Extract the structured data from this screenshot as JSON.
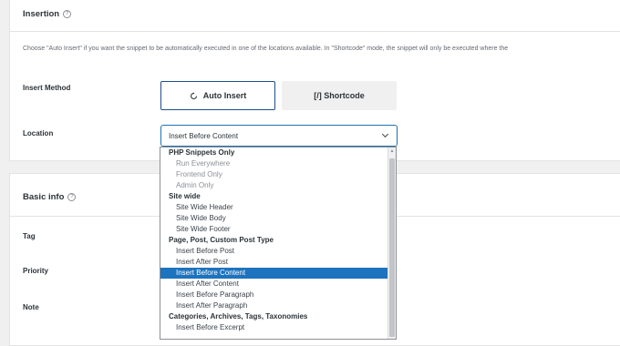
{
  "insertion": {
    "title": "Insertion",
    "description": "Choose \"Auto Insert\" if you want the snippet to be automatically executed in one of the locations available. In \"Shortcode\" mode, the snippet will only be executed where the",
    "insert_method_label": "Insert Method",
    "auto_insert_label": "Auto Insert",
    "shortcode_label": "[/] Shortcode",
    "location_label": "Location",
    "location_value": "Insert Before Content"
  },
  "basic_info": {
    "title": "Basic info",
    "tag_label": "Tag",
    "priority_label": "Priority",
    "note_label": "Note"
  },
  "dropdown": {
    "items": [
      {
        "type": "group",
        "label": "PHP Snippets Only"
      },
      {
        "type": "option",
        "label": "Run Everywhere",
        "state": "disabled"
      },
      {
        "type": "option",
        "label": "Frontend Only",
        "state": "disabled"
      },
      {
        "type": "option",
        "label": "Admin Only",
        "state": "disabled"
      },
      {
        "type": "group",
        "label": "Site wide"
      },
      {
        "type": "option",
        "label": "Site Wide Header",
        "state": "normal"
      },
      {
        "type": "option",
        "label": "Site Wide Body",
        "state": "normal"
      },
      {
        "type": "option",
        "label": "Site Wide Footer",
        "state": "normal"
      },
      {
        "type": "group",
        "label": "Page, Post, Custom Post Type"
      },
      {
        "type": "option",
        "label": "Insert Before Post",
        "state": "normal"
      },
      {
        "type": "option",
        "label": "Insert After Post",
        "state": "normal"
      },
      {
        "type": "option",
        "label": "Insert Before Content",
        "state": "selected"
      },
      {
        "type": "option",
        "label": "Insert After Content",
        "state": "normal"
      },
      {
        "type": "option",
        "label": "Insert Before Paragraph",
        "state": "normal"
      },
      {
        "type": "option",
        "label": "Insert After Paragraph",
        "state": "normal"
      },
      {
        "type": "group",
        "label": "Categories, Archives, Tags, Taxonomies"
      },
      {
        "type": "option",
        "label": "Insert Before Excerpt",
        "state": "normal"
      }
    ]
  },
  "colors": {
    "accent": "#2271b1",
    "selected_bg": "#1e73be",
    "auto_insert_border": "#1d4e89"
  },
  "icons": {
    "help": "question-circle-icon",
    "refresh": "refresh-icon",
    "chevron": "chevron-down-icon"
  }
}
